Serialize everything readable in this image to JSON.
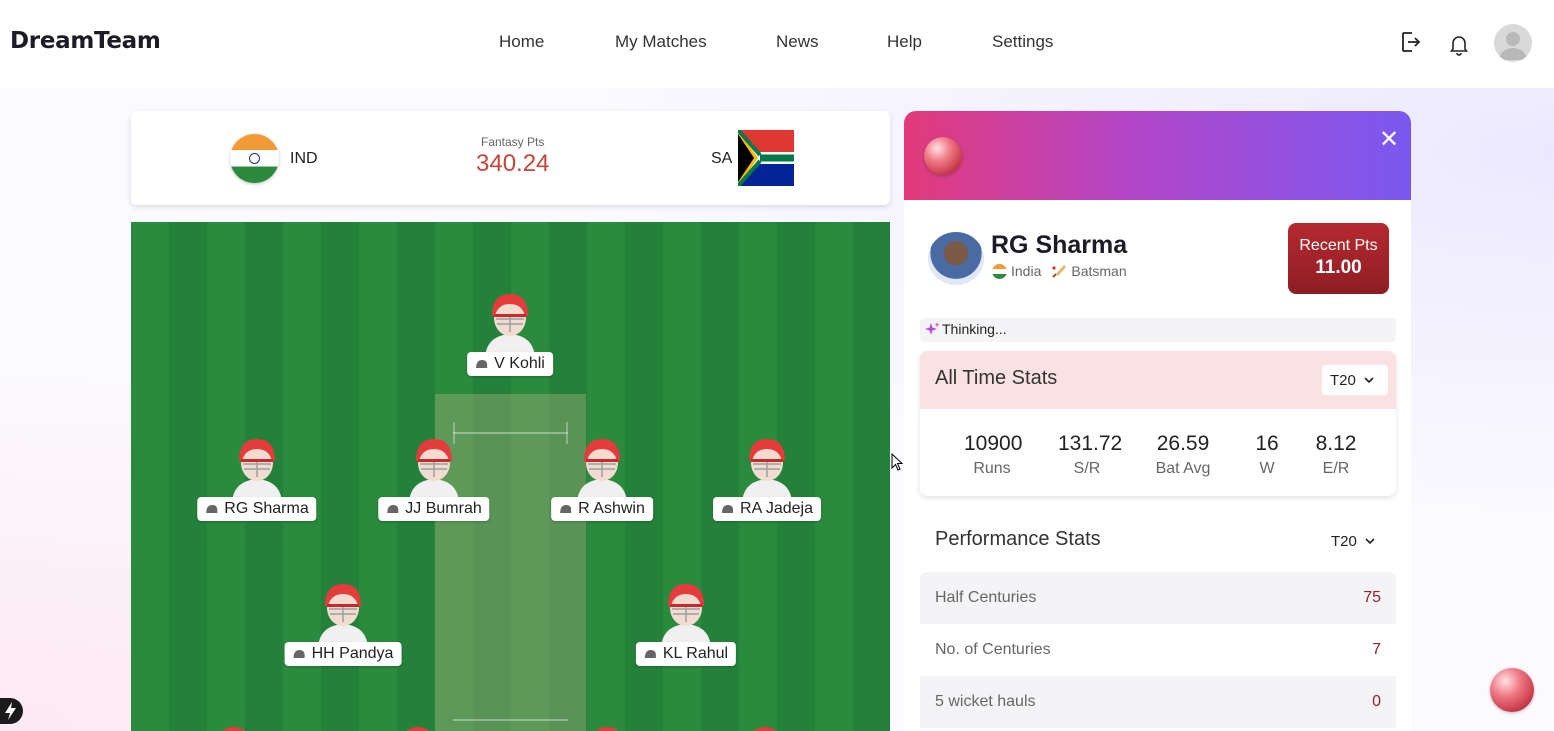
{
  "header": {
    "brand": "DreamTeam",
    "nav": [
      "Home",
      "My Matches",
      "News",
      "Help",
      "Settings"
    ]
  },
  "icons": {
    "logout": "logout-icon",
    "bell": "bell-icon",
    "avatar": "avatar-icon"
  },
  "match": {
    "team_a": "IND",
    "team_b": "SA",
    "fantasy_label": "Fantasy Pts",
    "fantasy_value": "340.24"
  },
  "players": [
    {
      "name": "V Kohli"
    },
    {
      "name": "RG Sharma"
    },
    {
      "name": "JJ Bumrah"
    },
    {
      "name": "R Ashwin"
    },
    {
      "name": "RA Jadeja"
    },
    {
      "name": "HH Pandya"
    },
    {
      "name": "KL Rahul"
    }
  ],
  "panel": {
    "player_name": "RG Sharma",
    "country": "India",
    "role": "Batsman",
    "recent_label": "Recent Pts",
    "recent_value": "11.00",
    "thinking": "Thinking...",
    "all_time": {
      "title": "All Time Stats",
      "format": "T20",
      "stats": [
        {
          "value": "10900",
          "label": "Runs"
        },
        {
          "value": "131.72",
          "label": "S/R"
        },
        {
          "value": "26.59",
          "label": "Bat Avg"
        },
        {
          "value": "16",
          "label": "W"
        },
        {
          "value": "8.12",
          "label": "E/R"
        }
      ]
    },
    "performance": {
      "title": "Performance Stats",
      "format": "T20",
      "rows": [
        {
          "label": "Half Centuries",
          "value": "75"
        },
        {
          "label": "No. of Centuries",
          "value": "7"
        },
        {
          "label": "5 wicket hauls",
          "value": "0"
        }
      ]
    }
  },
  "colors": {
    "accent_red": "#c4463b",
    "field_green": "#2a8a3e",
    "recent_bg": "#a3252b"
  }
}
